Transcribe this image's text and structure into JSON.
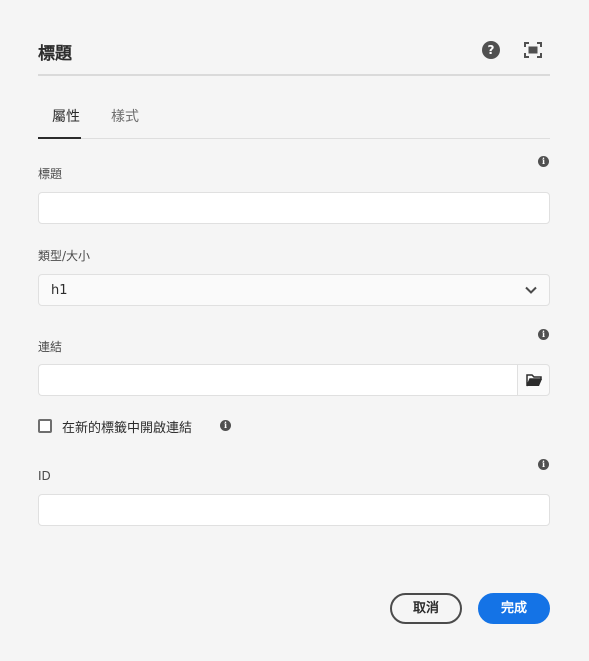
{
  "dialog": {
    "title": "標題",
    "help_icon_glyph": "?",
    "icons": {
      "help": "help-icon",
      "fullscreen": "fullscreen-icon"
    }
  },
  "tabs": [
    {
      "label": "屬性",
      "active": true
    },
    {
      "label": "樣式",
      "active": false
    }
  ],
  "fields": {
    "title": {
      "label": "標題",
      "value": ""
    },
    "type_size": {
      "label": "類型/大小",
      "value": "h1"
    },
    "link": {
      "label": "連結",
      "value": "",
      "browse_icon": "folder-icon"
    },
    "open_new_tab": {
      "label": "在新的標籤中開啟連結",
      "checked": false
    },
    "id": {
      "label": "ID",
      "value": ""
    }
  },
  "info_glyph": "i",
  "buttons": {
    "cancel": "取消",
    "done": "完成"
  },
  "colors": {
    "accent": "#1473e6",
    "background": "#f5f5f5",
    "icon": "#505050"
  }
}
